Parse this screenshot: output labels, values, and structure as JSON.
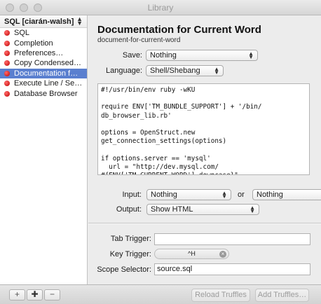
{
  "window": {
    "title": "Library"
  },
  "sidebar": {
    "bundle": "SQL  [ciarán-walsh]",
    "items": [
      {
        "label": "SQL"
      },
      {
        "label": "Completion"
      },
      {
        "label": "Preferences…"
      },
      {
        "label": "Copy Condensed…"
      },
      {
        "label": "Documentation f…",
        "selected": true
      },
      {
        "label": "Execute Line / Se…"
      },
      {
        "label": "Database Browser"
      }
    ]
  },
  "main": {
    "title": "Documentation for Current Word",
    "subtitle": "document-for-current-word",
    "save_label": "Save:",
    "save_value": "Nothing",
    "language_label": "Language:",
    "language_value": "Shell/Shebang",
    "code": "#!/usr/bin/env ruby -wKU\n\nrequire ENV['TM_BUNDLE_SUPPORT'] + '/bin/\ndb_browser_lib.rb'\n\noptions = OpenStruct.new\nget_connection_settings(options)\n\nif options.server == 'mysql'\n  url = \"http://dev.mysql.com/\n#{ENV['TM_CURRENT_WORD'].downcase}\"",
    "input_label": "Input:",
    "input_value": "Nothing",
    "or_label": "or",
    "input_fallback_value": "Nothing",
    "output_label": "Output:",
    "output_value": "Show HTML",
    "tab_trigger_label": "Tab Trigger:",
    "tab_trigger_value": "",
    "key_trigger_label": "Key Trigger:",
    "key_trigger_value": "^H",
    "scope_label": "Scope Selector:",
    "scope_value": "source.sql"
  },
  "bottombar": {
    "add_label": "+",
    "add_plus_label": "✚",
    "remove_label": "−",
    "reload_label": "Reload Truffles",
    "add_truffles_label": "Add Truffles…"
  }
}
